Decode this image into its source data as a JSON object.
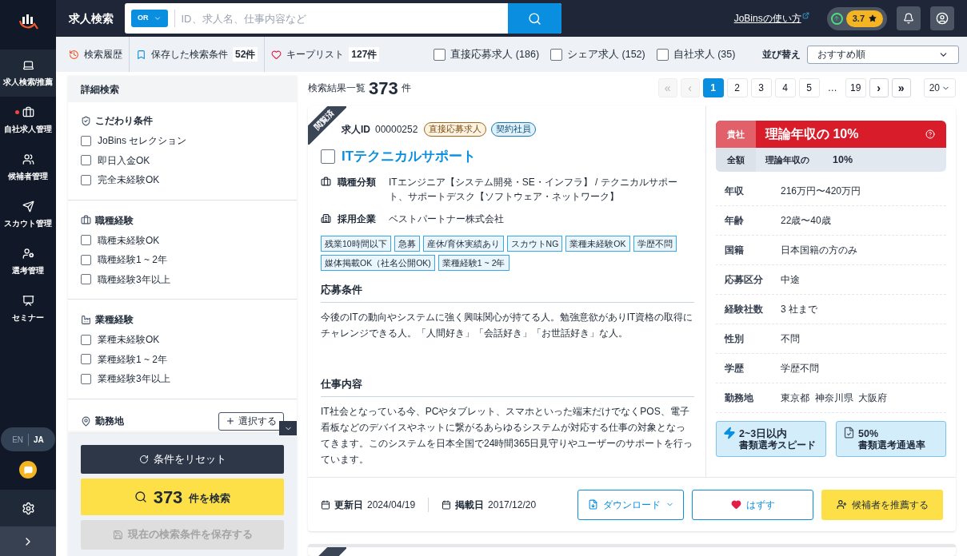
{
  "sidebar": {
    "items": [
      {
        "kind": "search",
        "label": "求人検索/推薦",
        "selected": true,
        "alert": false
      },
      {
        "kind": "jobs",
        "label": "自社求人管理",
        "selected": false,
        "alert": true
      },
      {
        "kind": "candidates",
        "label": "候補者管理",
        "selected": false,
        "alert": false
      },
      {
        "kind": "scout",
        "label": "スカウト管理",
        "selected": false,
        "alert": false
      },
      {
        "kind": "selection",
        "label": "選考管理",
        "selected": false,
        "alert": false
      },
      {
        "kind": "seminar",
        "label": "セミナー",
        "selected": false,
        "alert": false
      }
    ],
    "languages": [
      {
        "label": "EN",
        "selected": false
      },
      {
        "label": "JA",
        "selected": true
      }
    ]
  },
  "header": {
    "title": "求人検索",
    "search_mode": "OR",
    "search_placeholder": "ID、求人名、仕事内容など",
    "help_link": "JoBinsの使い方",
    "rating": "3.7"
  },
  "subbar": {
    "links": [
      {
        "kind": "history",
        "label": "検索履歴"
      },
      {
        "kind": "saved",
        "label": "保存した検索条件",
        "count": "52件"
      },
      {
        "kind": "keep",
        "label": "キープリスト",
        "count": "127件"
      }
    ],
    "filters": [
      {
        "label": "直接応募求人 (186)",
        "checked": false
      },
      {
        "label": "シェア求人 (152)",
        "checked": false
      },
      {
        "label": "自社求人 (35)",
        "checked": false
      }
    ],
    "sort_label": "並び替え",
    "sort_value": "おすすめ順"
  },
  "filter_panel": {
    "title": "詳細検索",
    "sections": [
      {
        "kind": "preference",
        "title": "こだわり条件",
        "options": [
          {
            "label": "JoBins セレクション",
            "checked": false
          },
          {
            "label": "即日入金OK",
            "checked": false
          },
          {
            "label": "完全未経験OK",
            "checked": false
          }
        ]
      },
      {
        "kind": "occupation",
        "title": "職種経験",
        "options": [
          {
            "label": "職種未経験OK",
            "checked": false
          },
          {
            "label": "職種経験1 ~ 2年",
            "checked": false
          },
          {
            "label": "職種経験3年以上",
            "checked": false
          }
        ]
      },
      {
        "kind": "industry",
        "title": "業種経験",
        "options": [
          {
            "label": "業種未経験OK",
            "checked": false
          },
          {
            "label": "業種経験1 ~ 2年",
            "checked": false
          },
          {
            "label": "業種経験3年以上",
            "checked": false
          }
        ]
      },
      {
        "kind": "location",
        "title": "勤務地",
        "button": "選択する"
      }
    ],
    "reset_button": "条件をリセット",
    "search_button": {
      "count": "373",
      "label": "件を検索"
    },
    "save_button": {
      "label": "現在の検索条件を保存する",
      "disabled": true
    }
  },
  "results": {
    "title": "検索結果一覧",
    "count": "373",
    "unit": "件",
    "pagination": [
      {
        "kind": "first",
        "label": "«",
        "disabled": true
      },
      {
        "kind": "prev",
        "label": "‹",
        "disabled": true
      },
      {
        "kind": "page",
        "label": "1",
        "selected": true
      },
      {
        "kind": "page",
        "label": "2",
        "selected": false
      },
      {
        "kind": "page",
        "label": "3",
        "selected": false
      },
      {
        "kind": "page",
        "label": "4",
        "selected": false
      },
      {
        "kind": "page",
        "label": "5",
        "selected": false
      },
      {
        "kind": "gap",
        "label": "…"
      },
      {
        "kind": "page",
        "label": "19",
        "selected": false
      },
      {
        "kind": "next",
        "label": "›",
        "disabled": false
      },
      {
        "kind": "last",
        "label": "»",
        "disabled": false
      }
    ],
    "per_page": "20"
  },
  "job": {
    "viewed": true,
    "viewed_label": "閲覧済",
    "id_label": "求人ID",
    "id": "00000252",
    "badges": [
      {
        "kind": "direct",
        "label": "直接応募求人"
      },
      {
        "kind": "contract",
        "label": "契約社員"
      }
    ],
    "title": "ITテクニカルサポート",
    "checked": false,
    "info": [
      {
        "kind": "job",
        "label": "職種分類",
        "value": "ITエンジニア【システム開発・SE・インフラ】 / テクニカルサポート、サポートデスク【ソフトウェア・ネットワーク】"
      },
      {
        "kind": "company",
        "label": "採用企業",
        "value": "ベストパートナー株式会社"
      }
    ],
    "tags": [
      "残業10時間以下",
      "急募",
      "産休/育休実績あり",
      "スカウトNG",
      "業種未経験OK",
      "学歴不問",
      "媒体掲載OK（社名公開OK)",
      "業種経験1 ~ 2年"
    ],
    "sections": [
      {
        "title": "応募条件",
        "text": "今後のITの動向やシステムに強く興味関心が持てる人。勉強意欲がありIT資格の取得にチャレンジできる人。「人間好き」「会話好き」「お世話好き」な人。"
      },
      {
        "title": "仕事内容",
        "text": "IT社会となっている今、PCやタブレット、スマホといった端末だけでなくPOS、電子看板などのデバイスやネットに繋がるあらゆるシステムが対応する仕事の対象となってきます。このシステムを日本全国で24時間365日見守りやユーザーのサポートを行っています。"
      }
    ],
    "fee": {
      "top_label": "貴社",
      "top_text": "理論年収の 10%",
      "bottom_label": "全額",
      "bottom_text": "理論年収の",
      "bottom_value": "10%"
    },
    "details": [
      {
        "label": "年収",
        "value": "216万円〜420万円"
      },
      {
        "label": "年齢",
        "value": "22歳〜40歳"
      },
      {
        "label": "国籍",
        "value": "日本国籍の方のみ"
      },
      {
        "label": "応募区分",
        "value": "中途"
      },
      {
        "label": "経験社数",
        "value": "3 社まで"
      },
      {
        "label": "性別",
        "value": "不問"
      },
      {
        "label": "学歴",
        "value": "学歴不問"
      },
      {
        "label": "勤務地",
        "value": "東京都  神奈川県  大阪府"
      }
    ],
    "stats": [
      {
        "kind": "speed",
        "value": "2~3日以内",
        "label": "書類選考スピード"
      },
      {
        "kind": "pass",
        "value": "50%",
        "label": "書類選考通過率"
      }
    ],
    "dates": [
      {
        "label": "更新日",
        "value": "2024/04/19"
      },
      {
        "label": "掲載日",
        "value": "2017/12/20"
      }
    ],
    "download": "ダウンロード",
    "remove": "はずす",
    "recommend": "候補者を推薦する"
  },
  "next_job": {
    "viewed": true
  }
}
